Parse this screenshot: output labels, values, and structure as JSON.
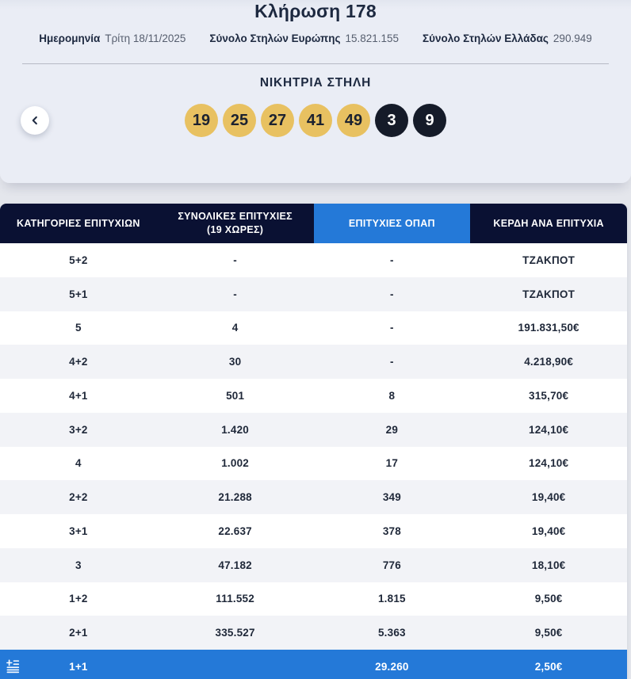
{
  "header": {
    "title": "Κλήρωση 178",
    "meta": [
      {
        "label": "Ημερομηνία",
        "value": "Τρίτη 18/11/2025"
      },
      {
        "label": "Σύνολο Στηλών Ευρώπης",
        "value": "15.821.155"
      },
      {
        "label": "Σύνολο Στηλών Ελλάδας",
        "value": "290.949"
      }
    ]
  },
  "winning_column": {
    "title": "ΝΙΚΗΤΡΙΑ ΣΤΗΛΗ",
    "main_numbers": [
      "19",
      "25",
      "27",
      "41",
      "49"
    ],
    "euro_numbers": [
      "3",
      "9"
    ]
  },
  "nav": {
    "prev_icon": "chevron-left-icon"
  },
  "table": {
    "columns": [
      {
        "label": "ΚΑΤΗΓΟΡΙΕΣ ΕΠΙΤΥΧΙΩΝ"
      },
      {
        "label": "ΣΥΝΟΛΙΚΕΣ ΕΠΙΤΥΧΙΕΣ",
        "sublabel": "(19 ΧΩΡΕΣ)"
      },
      {
        "label": "ΕΠΙΤΥΧΙΕΣ ΟΠΑΠ",
        "highlighted": true
      },
      {
        "label": "ΚΕΡΔΗ ΑΝΑ ΕΠΙΤΥΧΙΑ"
      }
    ],
    "rows": [
      {
        "cells": [
          "5+2",
          "-",
          "-",
          "ΤΖΑΚΠΟΤ"
        ],
        "highlight": false
      },
      {
        "cells": [
          "5+1",
          "-",
          "-",
          "ΤΖΑΚΠΟΤ"
        ],
        "highlight": false
      },
      {
        "cells": [
          "5",
          "4",
          "-",
          "191.831,50€"
        ],
        "highlight": false
      },
      {
        "cells": [
          "4+2",
          "30",
          "-",
          "4.218,90€"
        ],
        "highlight": false
      },
      {
        "cells": [
          "4+1",
          "501",
          "8",
          "315,70€"
        ],
        "highlight": false
      },
      {
        "cells": [
          "3+2",
          "1.420",
          "29",
          "124,10€"
        ],
        "highlight": false
      },
      {
        "cells": [
          "4",
          "1.002",
          "17",
          "124,10€"
        ],
        "highlight": false
      },
      {
        "cells": [
          "2+2",
          "21.288",
          "349",
          "19,40€"
        ],
        "highlight": false
      },
      {
        "cells": [
          "3+1",
          "22.637",
          "378",
          "19,40€"
        ],
        "highlight": false
      },
      {
        "cells": [
          "3",
          "47.182",
          "776",
          "18,10€"
        ],
        "highlight": false
      },
      {
        "cells": [
          "1+2",
          "111.552",
          "1.815",
          "9,50€"
        ],
        "highlight": false
      },
      {
        "cells": [
          "2+1",
          "335.527",
          "5.363",
          "9,50€"
        ],
        "highlight": false
      },
      {
        "cells": [
          "1+1",
          "",
          "29.260",
          "2,50€"
        ],
        "highlight": true,
        "icon": "greece-flag-icon"
      }
    ]
  },
  "colors": {
    "header_navy": "#0a1133",
    "accent_blue": "#2479d8",
    "ball_gold": "#e8c161",
    "ball_dark": "#151b29",
    "row_alt": "#f2f3f7",
    "ink": "#1d2940"
  }
}
